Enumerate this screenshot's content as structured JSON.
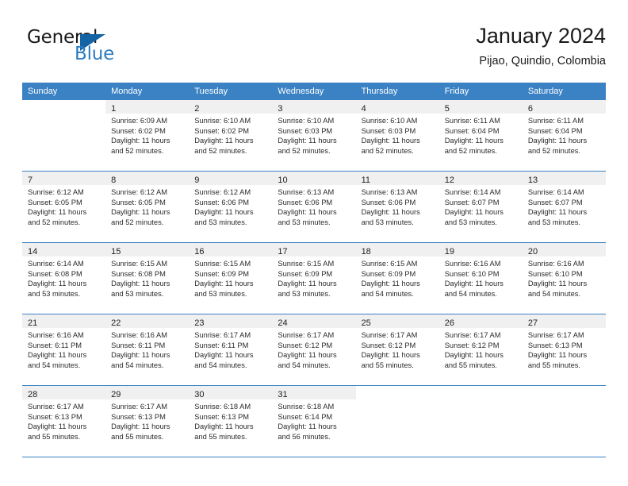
{
  "brand": {
    "name_top": "General",
    "name_bottom": "Blue",
    "triangle_color": "#1464a5",
    "blue_color": "#2b7cc0"
  },
  "header": {
    "title": "January 2024",
    "subtitle": "Pijao, Quindio, Colombia"
  },
  "theme": {
    "header_blue": "#3b82c4",
    "shaded_cell": "#f0f0f0",
    "text": "#2b2b2b"
  },
  "weekdays": [
    "Sunday",
    "Monday",
    "Tuesday",
    "Wednesday",
    "Thursday",
    "Friday",
    "Saturday"
  ],
  "weeks": [
    [
      {
        "day": "",
        "lines": []
      },
      {
        "day": "1",
        "lines": [
          "Sunrise: 6:09 AM",
          "Sunset: 6:02 PM",
          "Daylight: 11 hours",
          "and 52 minutes."
        ]
      },
      {
        "day": "2",
        "lines": [
          "Sunrise: 6:10 AM",
          "Sunset: 6:02 PM",
          "Daylight: 11 hours",
          "and 52 minutes."
        ]
      },
      {
        "day": "3",
        "lines": [
          "Sunrise: 6:10 AM",
          "Sunset: 6:03 PM",
          "Daylight: 11 hours",
          "and 52 minutes."
        ]
      },
      {
        "day": "4",
        "lines": [
          "Sunrise: 6:10 AM",
          "Sunset: 6:03 PM",
          "Daylight: 11 hours",
          "and 52 minutes."
        ]
      },
      {
        "day": "5",
        "lines": [
          "Sunrise: 6:11 AM",
          "Sunset: 6:04 PM",
          "Daylight: 11 hours",
          "and 52 minutes."
        ]
      },
      {
        "day": "6",
        "lines": [
          "Sunrise: 6:11 AM",
          "Sunset: 6:04 PM",
          "Daylight: 11 hours",
          "and 52 minutes."
        ]
      }
    ],
    [
      {
        "day": "7",
        "lines": [
          "Sunrise: 6:12 AM",
          "Sunset: 6:05 PM",
          "Daylight: 11 hours",
          "and 52 minutes."
        ]
      },
      {
        "day": "8",
        "lines": [
          "Sunrise: 6:12 AM",
          "Sunset: 6:05 PM",
          "Daylight: 11 hours",
          "and 52 minutes."
        ]
      },
      {
        "day": "9",
        "lines": [
          "Sunrise: 6:12 AM",
          "Sunset: 6:06 PM",
          "Daylight: 11 hours",
          "and 53 minutes."
        ]
      },
      {
        "day": "10",
        "lines": [
          "Sunrise: 6:13 AM",
          "Sunset: 6:06 PM",
          "Daylight: 11 hours",
          "and 53 minutes."
        ]
      },
      {
        "day": "11",
        "lines": [
          "Sunrise: 6:13 AM",
          "Sunset: 6:06 PM",
          "Daylight: 11 hours",
          "and 53 minutes."
        ]
      },
      {
        "day": "12",
        "lines": [
          "Sunrise: 6:14 AM",
          "Sunset: 6:07 PM",
          "Daylight: 11 hours",
          "and 53 minutes."
        ]
      },
      {
        "day": "13",
        "lines": [
          "Sunrise: 6:14 AM",
          "Sunset: 6:07 PM",
          "Daylight: 11 hours",
          "and 53 minutes."
        ]
      }
    ],
    [
      {
        "day": "14",
        "lines": [
          "Sunrise: 6:14 AM",
          "Sunset: 6:08 PM",
          "Daylight: 11 hours",
          "and 53 minutes."
        ]
      },
      {
        "day": "15",
        "lines": [
          "Sunrise: 6:15 AM",
          "Sunset: 6:08 PM",
          "Daylight: 11 hours",
          "and 53 minutes."
        ]
      },
      {
        "day": "16",
        "lines": [
          "Sunrise: 6:15 AM",
          "Sunset: 6:09 PM",
          "Daylight: 11 hours",
          "and 53 minutes."
        ]
      },
      {
        "day": "17",
        "lines": [
          "Sunrise: 6:15 AM",
          "Sunset: 6:09 PM",
          "Daylight: 11 hours",
          "and 53 minutes."
        ]
      },
      {
        "day": "18",
        "lines": [
          "Sunrise: 6:15 AM",
          "Sunset: 6:09 PM",
          "Daylight: 11 hours",
          "and 54 minutes."
        ]
      },
      {
        "day": "19",
        "lines": [
          "Sunrise: 6:16 AM",
          "Sunset: 6:10 PM",
          "Daylight: 11 hours",
          "and 54 minutes."
        ]
      },
      {
        "day": "20",
        "lines": [
          "Sunrise: 6:16 AM",
          "Sunset: 6:10 PM",
          "Daylight: 11 hours",
          "and 54 minutes."
        ]
      }
    ],
    [
      {
        "day": "21",
        "lines": [
          "Sunrise: 6:16 AM",
          "Sunset: 6:11 PM",
          "Daylight: 11 hours",
          "and 54 minutes."
        ]
      },
      {
        "day": "22",
        "lines": [
          "Sunrise: 6:16 AM",
          "Sunset: 6:11 PM",
          "Daylight: 11 hours",
          "and 54 minutes."
        ]
      },
      {
        "day": "23",
        "lines": [
          "Sunrise: 6:17 AM",
          "Sunset: 6:11 PM",
          "Daylight: 11 hours",
          "and 54 minutes."
        ]
      },
      {
        "day": "24",
        "lines": [
          "Sunrise: 6:17 AM",
          "Sunset: 6:12 PM",
          "Daylight: 11 hours",
          "and 54 minutes."
        ]
      },
      {
        "day": "25",
        "lines": [
          "Sunrise: 6:17 AM",
          "Sunset: 6:12 PM",
          "Daylight: 11 hours",
          "and 55 minutes."
        ]
      },
      {
        "day": "26",
        "lines": [
          "Sunrise: 6:17 AM",
          "Sunset: 6:12 PM",
          "Daylight: 11 hours",
          "and 55 minutes."
        ]
      },
      {
        "day": "27",
        "lines": [
          "Sunrise: 6:17 AM",
          "Sunset: 6:13 PM",
          "Daylight: 11 hours",
          "and 55 minutes."
        ]
      }
    ],
    [
      {
        "day": "28",
        "lines": [
          "Sunrise: 6:17 AM",
          "Sunset: 6:13 PM",
          "Daylight: 11 hours",
          "and 55 minutes."
        ]
      },
      {
        "day": "29",
        "lines": [
          "Sunrise: 6:17 AM",
          "Sunset: 6:13 PM",
          "Daylight: 11 hours",
          "and 55 minutes."
        ]
      },
      {
        "day": "30",
        "lines": [
          "Sunrise: 6:18 AM",
          "Sunset: 6:13 PM",
          "Daylight: 11 hours",
          "and 55 minutes."
        ]
      },
      {
        "day": "31",
        "lines": [
          "Sunrise: 6:18 AM",
          "Sunset: 6:14 PM",
          "Daylight: 11 hours",
          "and 56 minutes."
        ]
      },
      {
        "day": "",
        "lines": []
      },
      {
        "day": "",
        "lines": []
      },
      {
        "day": "",
        "lines": []
      }
    ]
  ]
}
